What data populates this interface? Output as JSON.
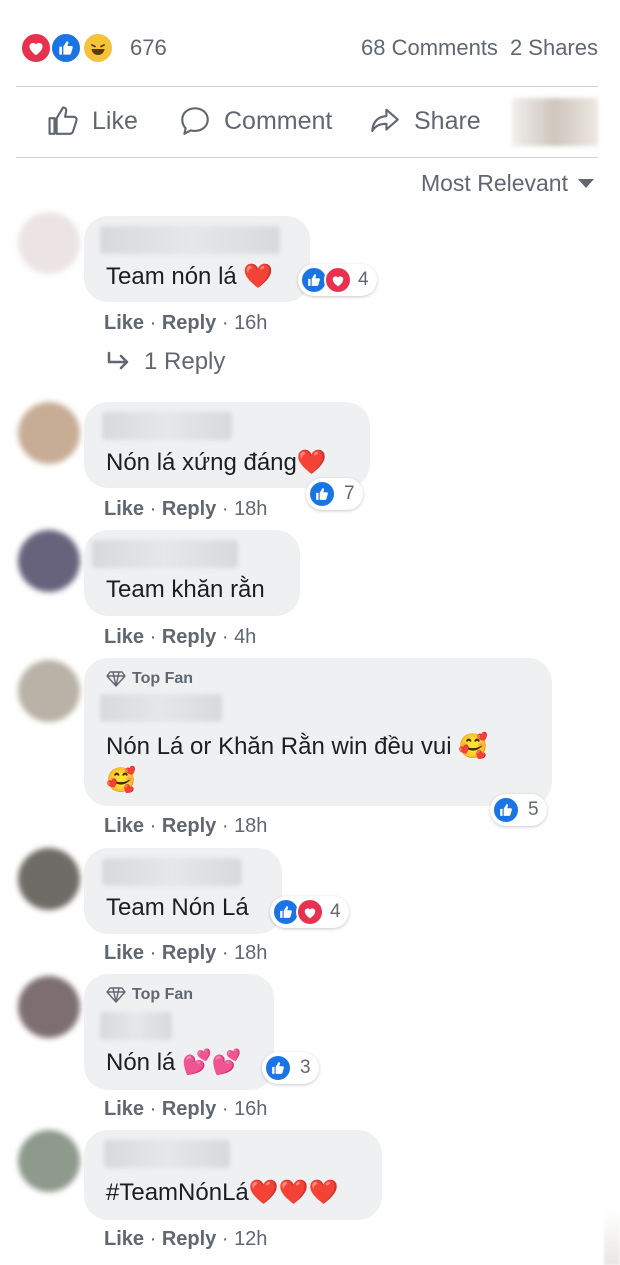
{
  "post_stats": {
    "reaction_count": "676",
    "comments": "68 Comments",
    "shares": "2 Shares",
    "reaction_icons": [
      "love-icon",
      "like-icon",
      "haha-icon"
    ]
  },
  "actions": {
    "like": "Like",
    "comment": "Comment",
    "share": "Share"
  },
  "sort": {
    "label": "Most Relevant"
  },
  "replies_link": "1 Reply",
  "colors": {
    "like_blue": "#1b74e4",
    "love_red": "#e8304f",
    "haha_yellow": "#f7c23b",
    "bubble_bg": "#eff0f2",
    "meta_gray": "#606770"
  },
  "comments": [
    {
      "text": "Team nón lá ❤️",
      "reaction_count": "4",
      "reactions": [
        "like",
        "love"
      ],
      "like_label": "Like",
      "reply_label": "Reply",
      "time": "16h",
      "top_fan": ""
    },
    {
      "text": "Nón lá xứng đáng❤️",
      "reaction_count": "7",
      "reactions": [
        "like"
      ],
      "like_label": "Like",
      "reply_label": "Reply",
      "time": "18h",
      "top_fan": ""
    },
    {
      "text": "Team khăn rằn",
      "reaction_count": "",
      "reactions": [],
      "like_label": "Like",
      "reply_label": "Reply",
      "time": "4h",
      "top_fan": ""
    },
    {
      "text_line1": "Nón Lá or Khăn Rằn win đều vui 🥰",
      "text_line2": "🥰",
      "reaction_count": "5",
      "reactions": [
        "like"
      ],
      "like_label": "Like",
      "reply_label": "Reply",
      "time": "18h",
      "top_fan": "Top Fan"
    },
    {
      "text": "Team Nón Lá",
      "reaction_count": "4",
      "reactions": [
        "like",
        "love"
      ],
      "like_label": "Like",
      "reply_label": "Reply",
      "time": "18h",
      "top_fan": ""
    },
    {
      "text": "Nón lá 💕💕",
      "reaction_count": "3",
      "reactions": [
        "like"
      ],
      "like_label": "Like",
      "reply_label": "Reply",
      "time": "16h",
      "top_fan": "Top Fan"
    },
    {
      "text": "#TeamNónLá❤️❤️❤️",
      "reaction_count": "",
      "reactions": [],
      "like_label": "Like",
      "reply_label": "Reply",
      "time": "12h",
      "top_fan": ""
    }
  ]
}
